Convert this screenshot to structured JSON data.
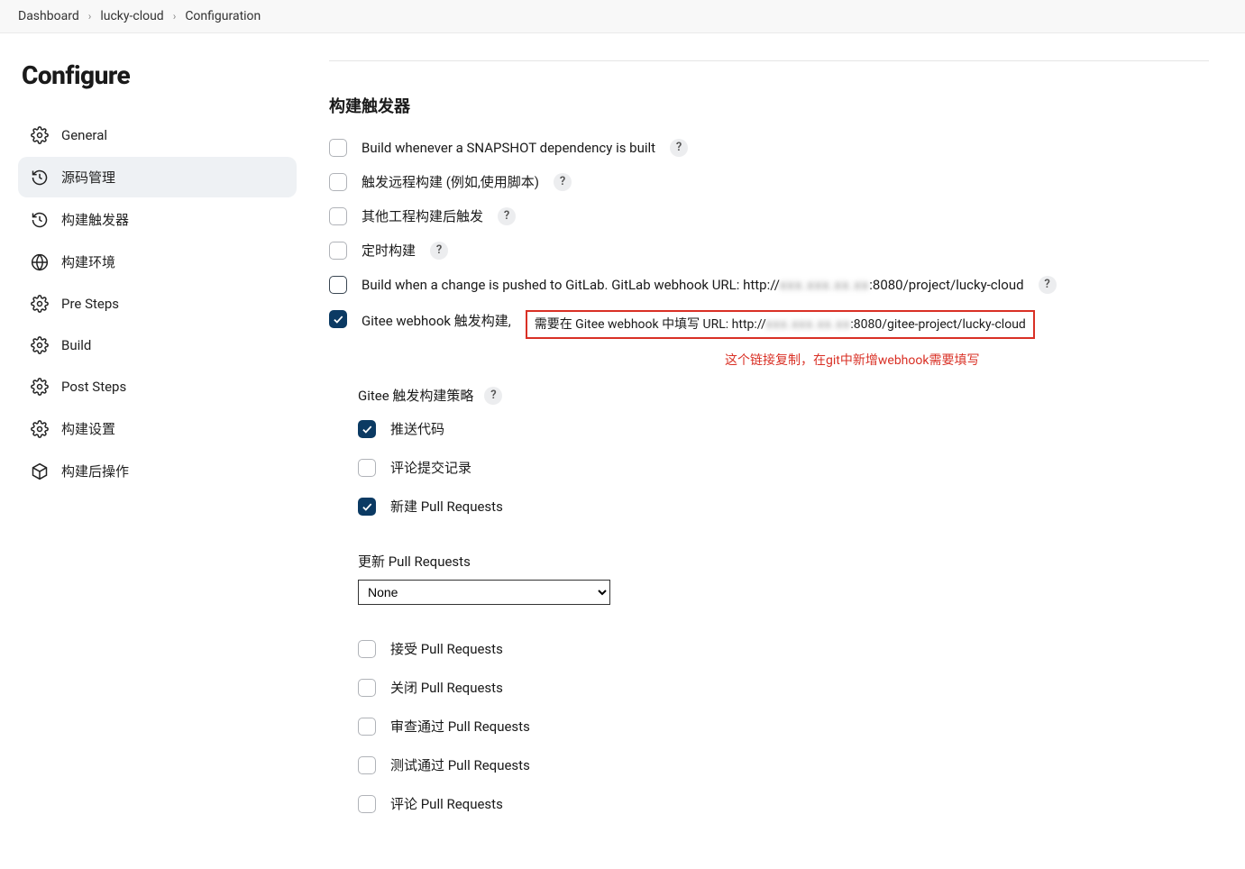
{
  "breadcrumb": {
    "items": [
      "Dashboard",
      "lucky-cloud",
      "Configuration"
    ]
  },
  "sidebar": {
    "title": "Configure",
    "items": [
      {
        "icon": "gear",
        "label": "General"
      },
      {
        "icon": "history",
        "label": "源码管理",
        "active": true
      },
      {
        "icon": "history",
        "label": "构建触发器"
      },
      {
        "icon": "globe",
        "label": "构建环境"
      },
      {
        "icon": "gear",
        "label": "Pre Steps"
      },
      {
        "icon": "gear",
        "label": "Build"
      },
      {
        "icon": "gear",
        "label": "Post Steps"
      },
      {
        "icon": "gear",
        "label": "构建设置"
      },
      {
        "icon": "cube",
        "label": "构建后操作"
      }
    ]
  },
  "section": {
    "title": "构建触发器",
    "options": {
      "snapshot": "Build whenever a SNAPSHOT dependency is built",
      "remote": "触发远程构建 (例如,使用脚本)",
      "other": "其他工程构建后触发",
      "timer": "定时构建",
      "gitlab_prefix": "Build when a change is pushed to GitLab. GitLab webhook URL: http://",
      "gitlab_host_blur": "xxx.xxx.xx.xx",
      "gitlab_suffix": ":8080/project/lucky-cloud",
      "gitee_prefix": "Gitee webhook 触发构建,",
      "gitee_box_prefix": "需要在 Gitee webhook 中填写 URL: http://",
      "gitee_host_blur": "xxx.xxx.xx.xx",
      "gitee_box_suffix": ":8080/gitee-project/lucky-cloud",
      "annotation": "这个链接复制，在git中新增webhook需要填写"
    },
    "gitee": {
      "strategy_label": "Gitee 触发构建策略",
      "push": "推送代码",
      "comment_commit": "评论提交记录",
      "new_pr": "新建 Pull Requests",
      "update_pr_label": "更新 Pull Requests",
      "update_pr_value": "None",
      "accept_pr": "接受 Pull Requests",
      "close_pr": "关闭 Pull Requests",
      "approve_pr": "审查通过 Pull Requests",
      "test_pr": "测试通过 Pull Requests",
      "comment_pr": "评论 Pull Requests"
    }
  }
}
